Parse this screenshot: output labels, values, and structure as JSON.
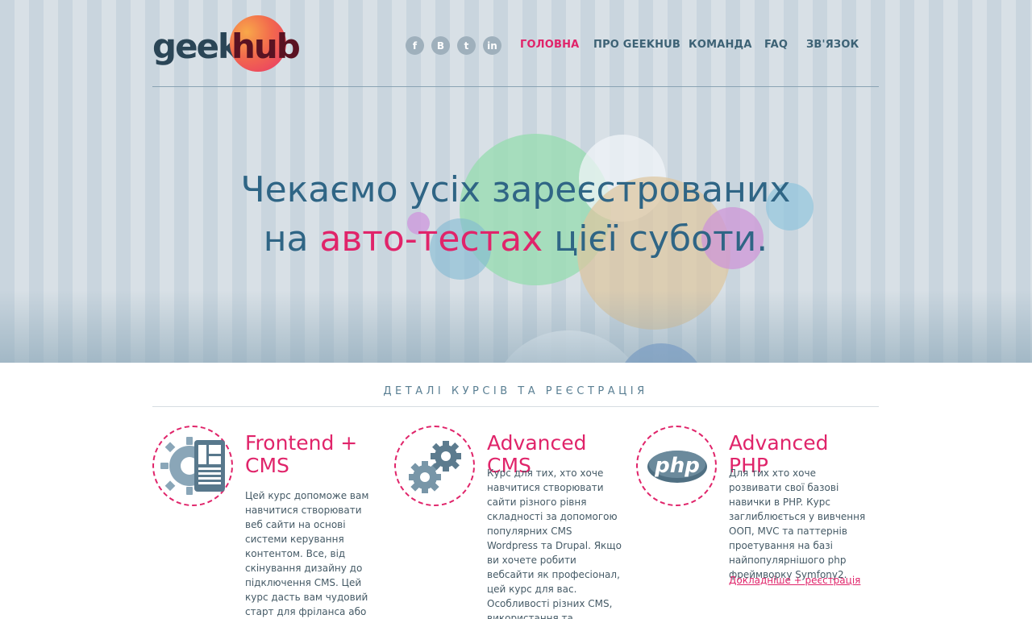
{
  "logo": {
    "part1": "geek",
    "part2": "hub"
  },
  "social": [
    {
      "icon": "facebook-icon",
      "glyph": "f"
    },
    {
      "icon": "vk-icon",
      "glyph": "B"
    },
    {
      "icon": "twitter-icon",
      "glyph": "t"
    },
    {
      "icon": "odnoklassniki-icon",
      "glyph": "in"
    }
  ],
  "nav": {
    "home": "ГОЛОВНА",
    "about": "ПРО GEEKHUB",
    "team": "КОМАНДА",
    "faq": "FAQ",
    "contact": "ЗВ'ЯЗОК"
  },
  "hero": {
    "line1": "Чекаємо усіх зареєстрованих",
    "line2_pre": "на ",
    "line2_highlight": "авто-тестах",
    "line2_post": " цієї суботи."
  },
  "section": {
    "title": "ДЕТАЛІ КУРСІВ ТА РЕЄСТРАЦІЯ"
  },
  "courses": [
    {
      "title": "Frontend + CMS",
      "icon": "frontend-layout-gear-icon",
      "description": "Цей курс допоможе вам навчитися створювати веб сайти на основі системи керування контентом. Все, від скінування дизайну до підключення CMS. Цей курс дасть вам чудовий старт для фріланса або роботи в компанії."
    },
    {
      "title": "Advanced CMS",
      "icon": "gears-icon",
      "description": "Курс для тих, хто хоче навчитися створювати сайти різного рівня складності за допомогою популярних CMS Wordpress та Drupal. Якщо ви хочете робити вебсайти як професіонал, цей курс для вас. Особливості різних CMS, використання та написання плагінів та"
    },
    {
      "title": "Advanced PHP",
      "icon": "php-logo-icon",
      "description": "Для тих хто хоче розвивати свої базові навички в PHP. Курс заглиблюється у вивчення ООП, MVC та паттернів проетування на базі найпопулярнішого php фреймворку Symfony2.",
      "link": "Докладніше + реєстрація"
    }
  ],
  "colors": {
    "accent": "#e0246a",
    "heading_blue": "#2f6585",
    "nav": "#3d6275"
  }
}
